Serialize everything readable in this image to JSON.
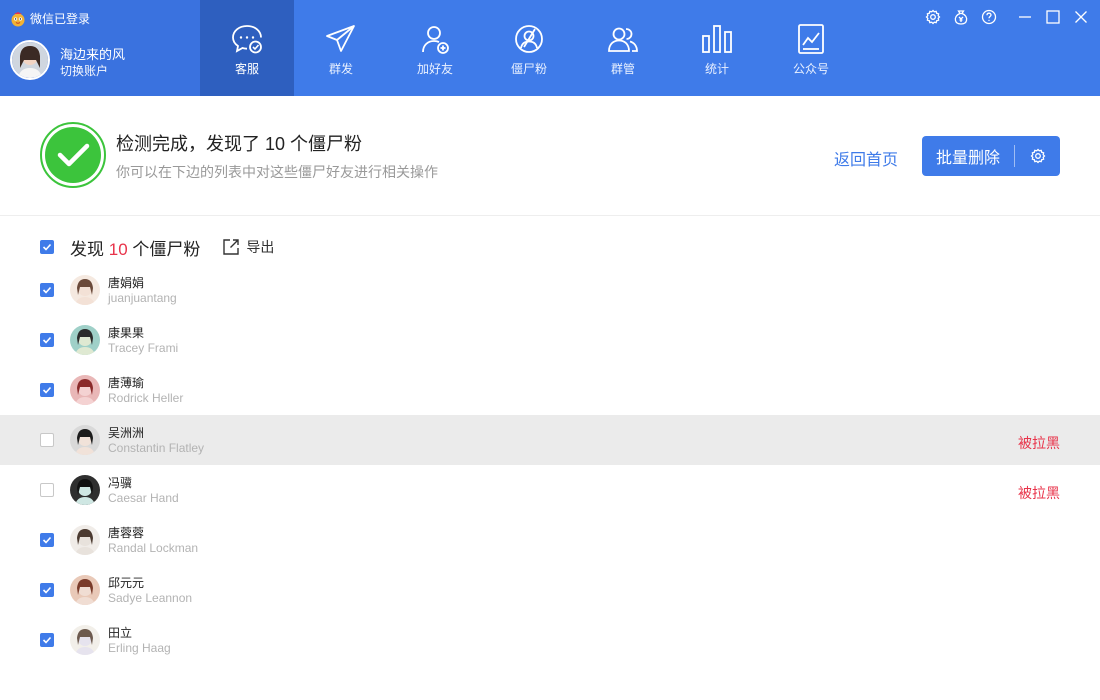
{
  "app": {
    "login_status": "微信已登录"
  },
  "user": {
    "name": "海边来的风",
    "switch_label": "切换账户"
  },
  "nav": [
    {
      "label": "客服",
      "icon": "chat-bubble-icon",
      "active": true
    },
    {
      "label": "群发",
      "icon": "paper-plane-icon"
    },
    {
      "label": "加好友",
      "icon": "add-friend-icon"
    },
    {
      "label": "僵尸粉",
      "icon": "zombie-fans-icon"
    },
    {
      "label": "群管",
      "icon": "group-manage-icon"
    },
    {
      "label": "统计",
      "icon": "bar-stats-icon"
    },
    {
      "label": "公众号",
      "icon": "official-account-icon"
    }
  ],
  "banner": {
    "title": "检测完成，发现了 10 个僵尸粉",
    "subtitle": "你可以在下边的列表中对这些僵尸好友进行相关操作",
    "back_home": "返回首页",
    "batch_delete": "批量删除"
  },
  "summary": {
    "prefix": "发现",
    "count": "10",
    "suffix": "个僵尸粉",
    "export": "导出"
  },
  "friends": [
    {
      "name": "唐娟娟",
      "sub": "juanjuantang",
      "checked": true,
      "status": ""
    },
    {
      "name": "康果果",
      "sub": "Tracey Frami",
      "checked": true,
      "status": ""
    },
    {
      "name": "唐薄瑜",
      "sub": "Rodrick Heller",
      "checked": true,
      "status": ""
    },
    {
      "name": "吴洲洲",
      "sub": "Constantin Flatley",
      "checked": false,
      "status": "被拉黑",
      "highlight": true
    },
    {
      "name": "冯骥",
      "sub": "Caesar Hand",
      "checked": false,
      "status": "被拉黑"
    },
    {
      "name": "唐蓉蓉",
      "sub": "Randal Lockman",
      "checked": true,
      "status": ""
    },
    {
      "name": "邱元元",
      "sub": "Sadye Leannon",
      "checked": true,
      "status": ""
    },
    {
      "name": "田立",
      "sub": "Erling Haag",
      "checked": true,
      "status": ""
    }
  ],
  "colors": {
    "brand": "#3f7be9",
    "danger": "#e8334a",
    "success": "#3cc43c"
  }
}
